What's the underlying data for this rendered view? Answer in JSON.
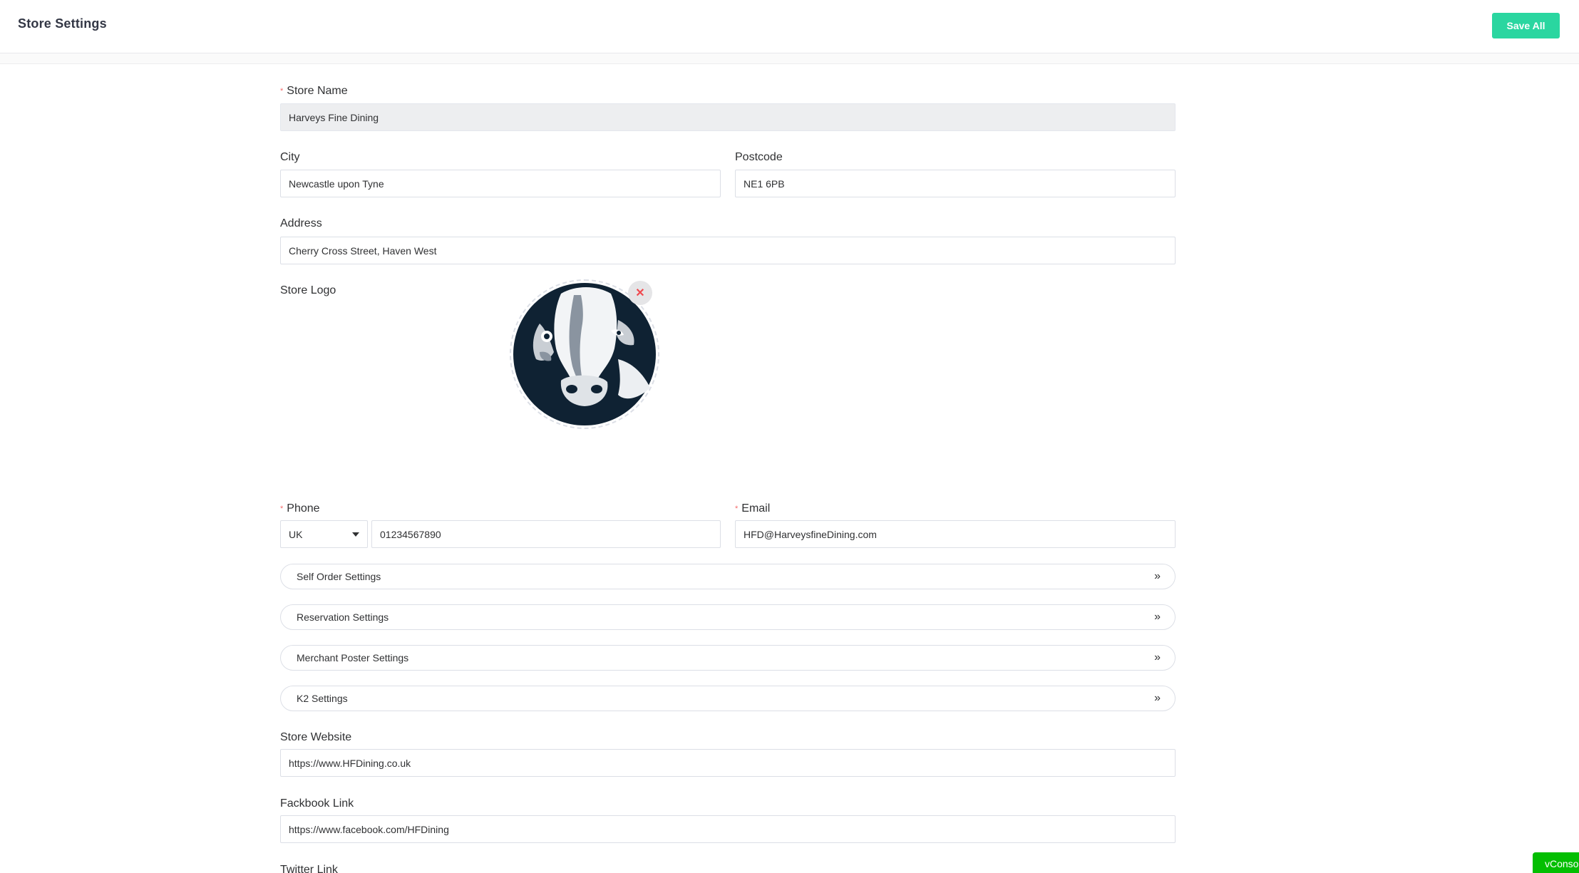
{
  "header": {
    "title": "Store Settings",
    "save_label": "Save All",
    "accent_color": "#2ad6a0"
  },
  "form": {
    "store_name": {
      "label": "Store Name",
      "required": true,
      "value": "Harveys Fine Dining",
      "disabled": true
    },
    "city": {
      "label": "City",
      "value": "Newcastle upon Tyne"
    },
    "postcode": {
      "label": "Postcode",
      "value": "NE1 6PB"
    },
    "address": {
      "label": "Address",
      "value": "Cherry Cross Street, Haven West"
    },
    "logo": {
      "label": "Store Logo",
      "image_icon": "horse-head-logo",
      "remove_icon": "close-icon"
    },
    "phone": {
      "label": "Phone",
      "required": true,
      "country": "UK",
      "value": "01234567890"
    },
    "email": {
      "label": "Email",
      "required": true,
      "value": "HFD@HarveysfineDining.com"
    },
    "sections": [
      {
        "label": "Self Order Settings"
      },
      {
        "label": "Reservation Settings"
      },
      {
        "label": "Merchant Poster Settings"
      },
      {
        "label": "K2 Settings"
      }
    ],
    "section_chevron": "»",
    "website": {
      "label": "Store Website",
      "value": "https://www.HFDining.co.uk"
    },
    "facebook": {
      "label": "Fackbook Link",
      "value": "https://www.facebook.com/HFDining"
    },
    "twitter": {
      "label": "Twitter Link"
    },
    "required_marker": "*"
  },
  "vconsole": {
    "label": "vConsole"
  }
}
